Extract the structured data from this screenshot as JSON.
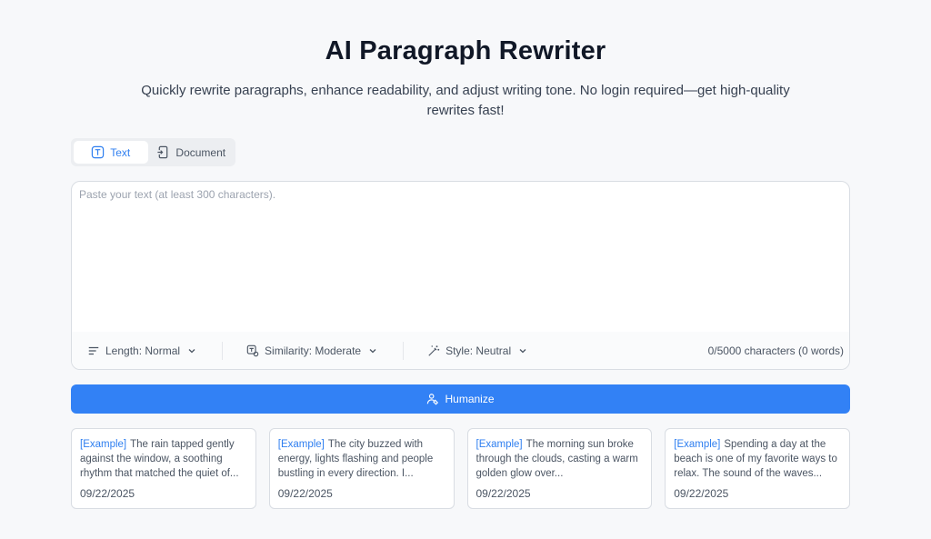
{
  "page": {
    "title": "AI Paragraph Rewriter",
    "subtitle": "Quickly rewrite paragraphs, enhance readability, and adjust writing tone. No login required—get high-quality rewrites fast!"
  },
  "mode_tabs": [
    {
      "label": "Text",
      "icon": "text-icon",
      "active": true
    },
    {
      "label": "Document",
      "icon": "document-icon",
      "active": false
    }
  ],
  "editor": {
    "placeholder": "Paste your text (at least 300 characters).",
    "value": "",
    "options": {
      "length": "Length: Normal",
      "similarity": "Similarity: Moderate",
      "style": "Style: Neutral"
    },
    "char_count": "0/5000 characters (0 words)"
  },
  "humanize_button": {
    "label": "Humanize",
    "icon": "humanize-icon"
  },
  "examples": [
    {
      "tag": "[Example]",
      "text": "The rain tapped gently against the window, a soothing rhythm that matched the quiet of...",
      "date": "09/22/2025"
    },
    {
      "tag": "[Example]",
      "text": "The city buzzed with energy, lights flashing and people bustling in every direction. I...",
      "date": "09/22/2025"
    },
    {
      "tag": "[Example]",
      "text": "The morning sun broke through the clouds, casting a warm golden glow over...",
      "date": "09/22/2025"
    },
    {
      "tag": "[Example]",
      "text": "Spending a day at the beach is one of my favorite ways to relax. The sound of the waves...",
      "date": "09/22/2025"
    }
  ],
  "colors": {
    "accent": "#3281f5",
    "background": "#f7f8fa",
    "border": "#d9dde3"
  }
}
